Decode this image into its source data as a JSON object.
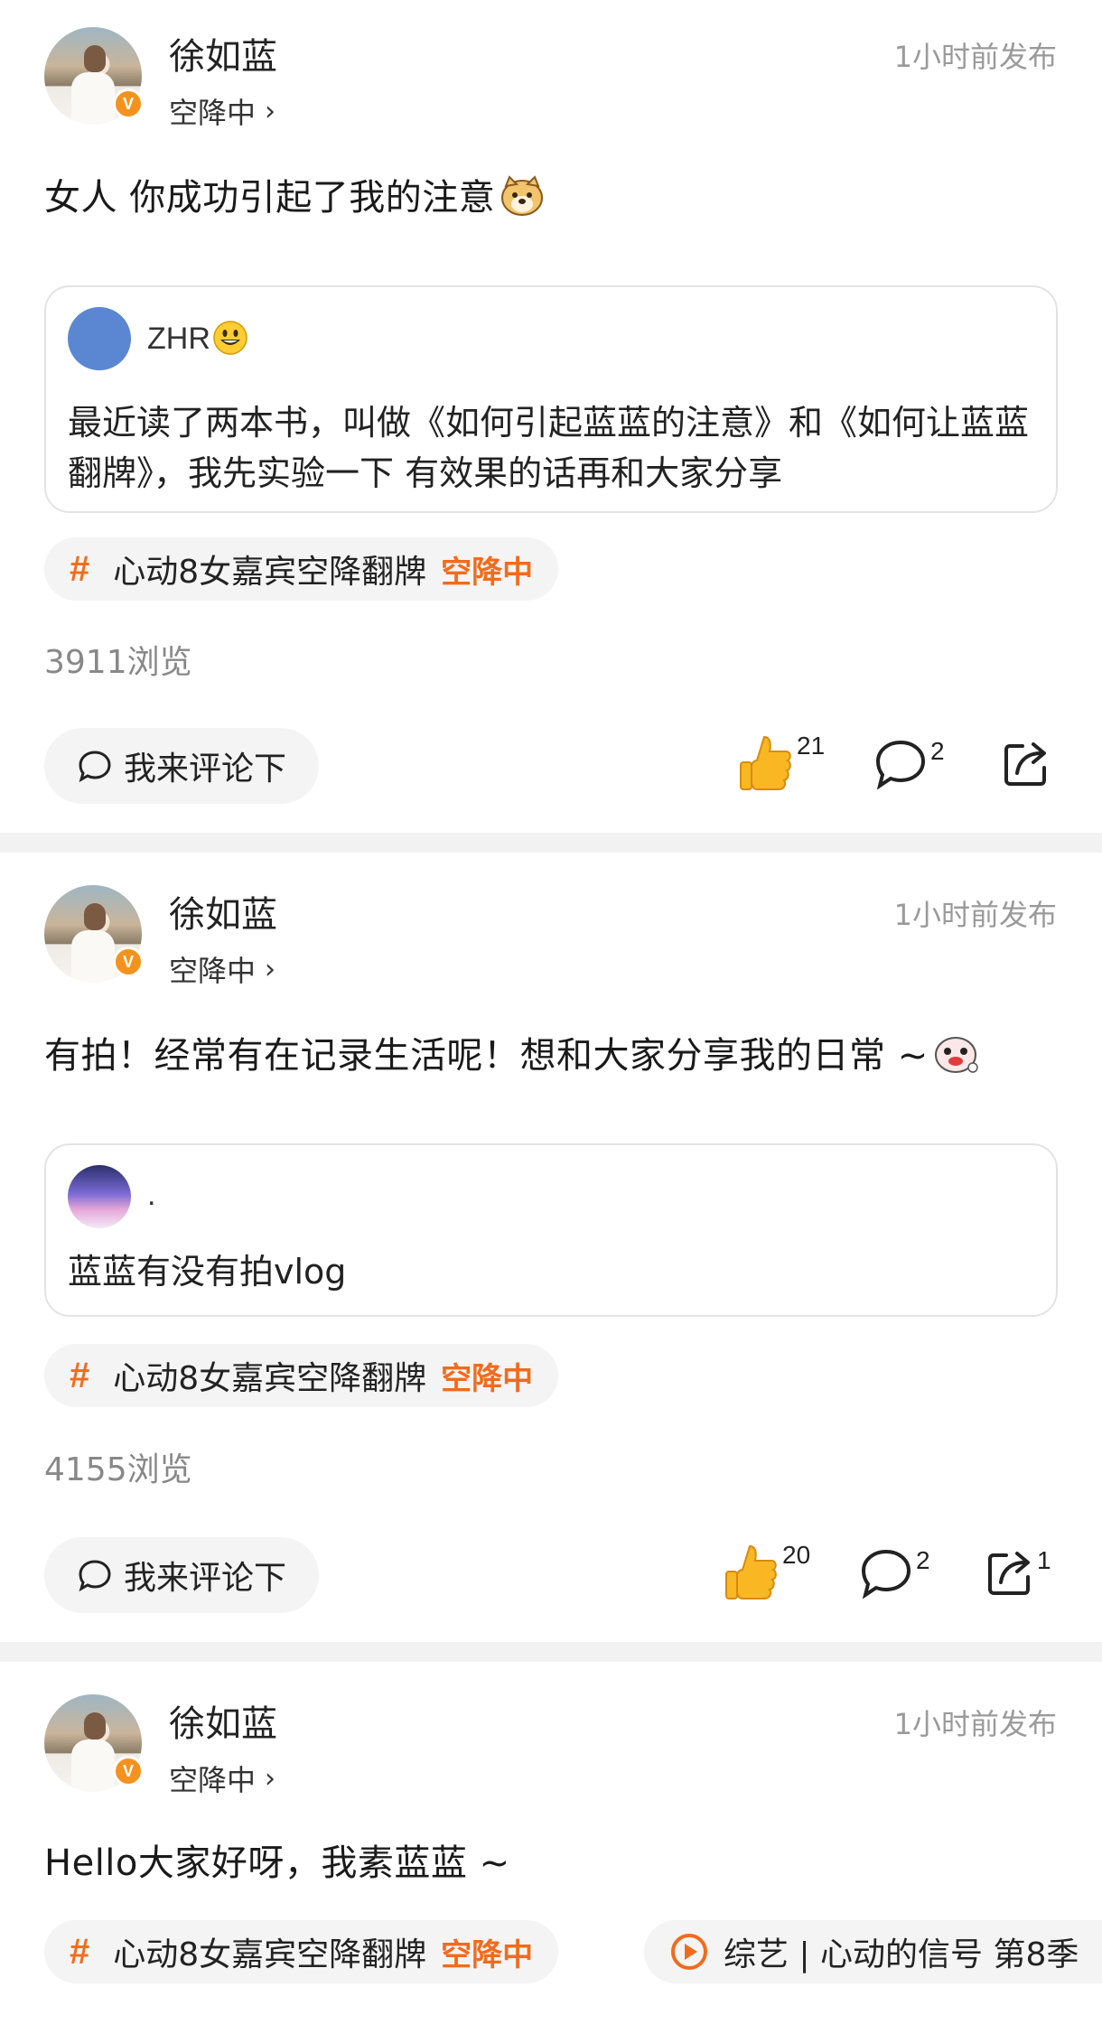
{
  "posts": [
    {
      "author": "徐如蓝",
      "status": "空降中",
      "time": "1小时前发布",
      "content": "女人 你成功引起了我的注意",
      "quote": {
        "name": "ZHR",
        "text": "最近读了两本书，叫做《如何引起蓝蓝的注意》和《如何让蓝蓝翻牌》，我先实验一下 有效果的话再和大家分享"
      },
      "topic": {
        "name": "心动8女嘉宾空降翻牌",
        "tag": "空降中"
      },
      "views": "3911浏览",
      "comment_btn": "我来评论下",
      "likes": "21",
      "comments": "2",
      "shares": ""
    },
    {
      "author": "徐如蓝",
      "status": "空降中",
      "time": "1小时前发布",
      "content": "有拍！经常有在记录生活呢！想和大家分享我的日常 ~",
      "quote": {
        "name": ".",
        "text": "蓝蓝有没有拍vlog"
      },
      "topic": {
        "name": "心动8女嘉宾空降翻牌",
        "tag": "空降中"
      },
      "views": "4155浏览",
      "comment_btn": "我来评论下",
      "likes": "20",
      "comments": "2",
      "shares": "1"
    },
    {
      "author": "徐如蓝",
      "status": "空降中",
      "time": "1小时前发布",
      "content": "Hello大家好呀，我素蓝蓝 ~",
      "topic": {
        "name": "心动8女嘉宾空降翻牌",
        "tag": "空降中"
      },
      "show_tag": "综艺 | 心动的信号 第8季"
    }
  ],
  "colors": {
    "accent": "#f26b1d",
    "badge": "#f5921e",
    "pill_bg": "#f4f4f4",
    "muted": "#9a9a9a"
  },
  "icons": [
    "verified-badge-icon",
    "chevron-right-icon",
    "comment-bubble-icon",
    "thumbs-up-icon",
    "share-icon",
    "play-circle-icon"
  ]
}
